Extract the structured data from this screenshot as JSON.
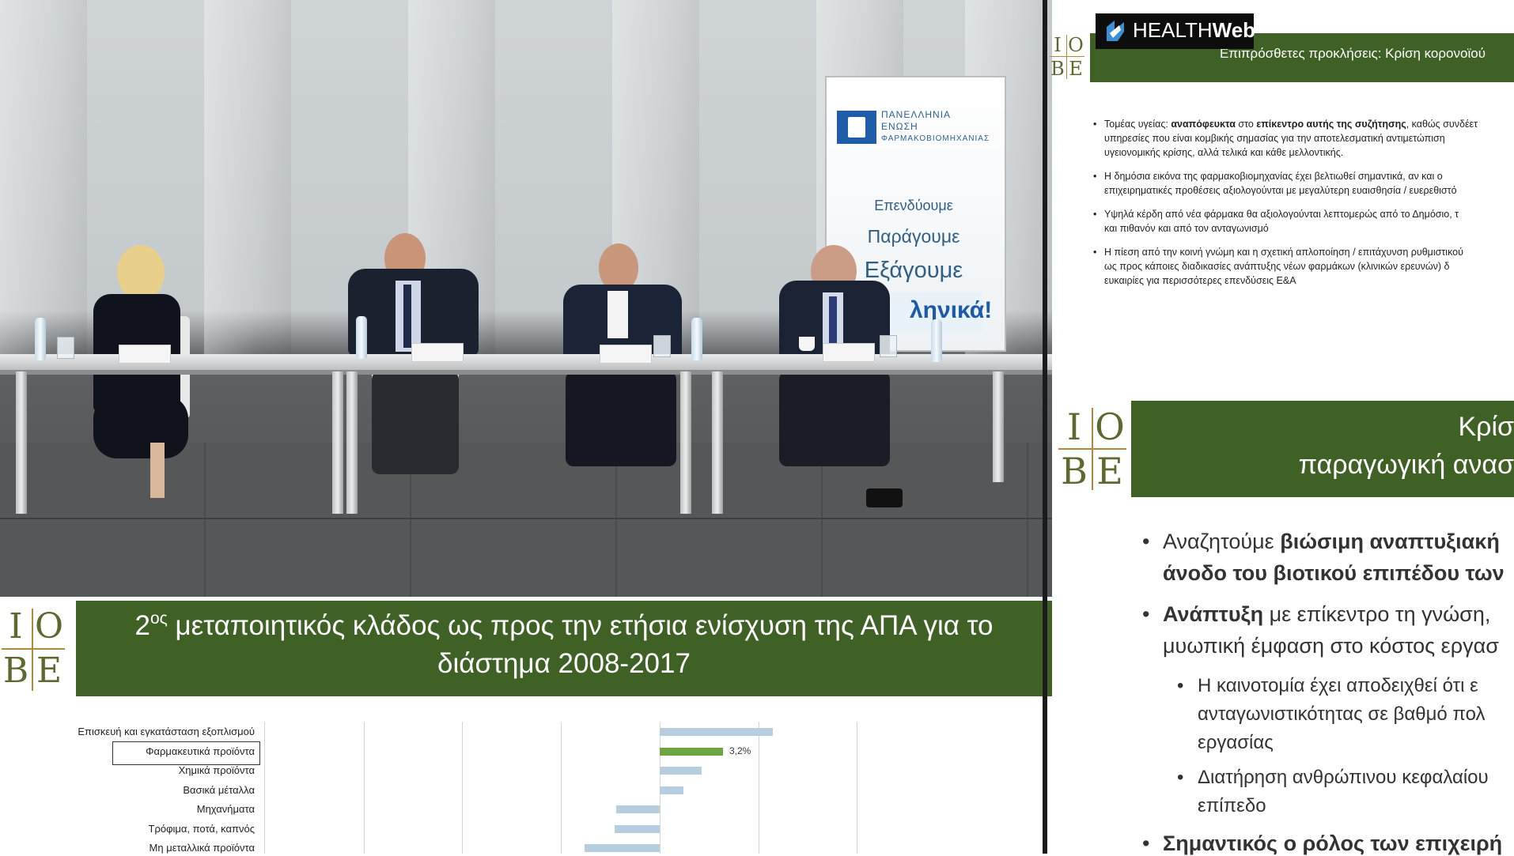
{
  "video": {
    "banner": {
      "org_line1": "ΠΑΝΕΛΛΗΝΙΑ",
      "org_line2": "ΕΝΩΣΗ",
      "org_line3": "ΦΑΡΜΑΚΟΒΙΟΜΗΧΑΝΙΑΣ",
      "word1": "Επενδύουμε",
      "word2": "Παράγουμε",
      "word3": "Εξάγουμε",
      "word4": "ληνικά!"
    }
  },
  "logo": {
    "letters": [
      "I",
      "O",
      "B",
      "E"
    ]
  },
  "bottom_slide": {
    "title_prefix": "2",
    "title_sup": "ος",
    "title_line1_rest": " μεταποιητικός κλάδος ως προς την ετήσια ενίσχυση της ΑΠΑ για το",
    "title_line2": "διάστημα 2008-2017"
  },
  "chart_data": {
    "type": "bar",
    "orientation": "horizontal",
    "categories": [
      "Επισκευή και εγκατάσταση εξοπλισμού",
      "Φαρμακευτικά προϊόντα",
      "Χημικά προϊόντα",
      "Βασικά μέταλλα",
      "Μηχανήματα",
      "Τρόφιμα, ποτά, καπνός",
      "Μη μεταλλικά προϊόντα"
    ],
    "values": [
      5.7,
      3.2,
      2.1,
      1.2,
      -2.2,
      -2.3,
      -3.8
    ],
    "data_labels": [
      "",
      "3,2%",
      "",
      "",
      "",
      "",
      ""
    ],
    "highlight": "Φαρμακευτικά προϊόντα",
    "colors": {
      "default": "#b7cde0",
      "highlight": "#6ea443"
    }
  },
  "right_panel": {
    "watermark": {
      "brand_part1": "HEALTH",
      "brand_part2": "Web"
    },
    "top_slide": {
      "title": "Επιπρόσθετες προκλήσεις: Κρίση κορονοϊού",
      "bullets": [
        {
          "lines": [
            "Τομέας υγείας: ",
            "αναπόφευκτα",
            " στο ",
            "επίκεντρο αυτής της συζήτησης",
            ", καθώς συνδέετ"
          ],
          "line2": "υπηρεσίες που είναι κομβικής σημασίας για την αποτελεσματική αντιμετώπιση",
          "line3": "υγειονομικής κρίσης, αλλά τελικά και κάθε μελλοντικής."
        },
        {
          "line1": "Η δημόσια εικόνα της φαρμακοβιομηχανίας έχει βελτιωθεί σημαντικά, αν και ο",
          "line2": "επιχειρηματικές προθέσεις αξιολογούνται με μεγαλύτερη ευαισθησία / ευερεθιστό"
        },
        {
          "line1": "Υψηλά κέρδη από νέα φάρμακα θα αξιολογούνται λεπτομερώς από το Δημόσιο, τ",
          "line2": "και πιθανόν και από τον ανταγωνισμό"
        },
        {
          "line1": "Η πίεση από την κοινή γνώμη και η σχετική απλοποίηση / επιτάχυνση ρυθμιστικού",
          "line2": "ως προς κάποιες διαδικασίες ανάπτυξης νέων φαρμάκων (κλινικών ερευνών) δ",
          "line3": "ευκαιρίες για περισσότερες επενδύσεις Ε&Α"
        }
      ]
    },
    "bottom_slide": {
      "title_line1": "Κρίσ",
      "title_line2": "παραγωγική ανασ",
      "b1_pre": "Αναζητούμε ",
      "b1_bold": "βιώσιμη αναπτυξιακή",
      "b1_line2": "άνοδο του βιοτικού επιπέδου των",
      "b2_bold": "Ανάπτυξη",
      "b2_rest": " με επίκεντρο τη γνώση,",
      "b2_line2": "μυωπική έμφαση στο κόστος εργασ",
      "sub1_line1": "Η καινοτομία έχει αποδειχθεί ότι ε",
      "sub1_line2": "ανταγωνιστικότητας σε βαθμό πολ",
      "sub1_line3": "εργασίας",
      "sub2_line1": "Διατήρηση ανθρώπινου κεφαλαίου",
      "sub2_line2": "επίπεδο",
      "b3_bold": "Σημαντικός ο ρόλος των επιχειρή"
    }
  }
}
